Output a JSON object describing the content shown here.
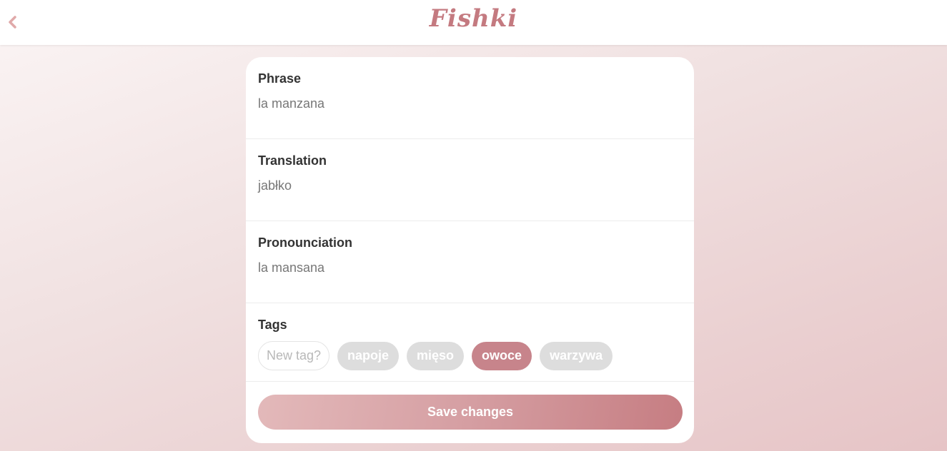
{
  "app": {
    "title": "Fishki",
    "back_icon": "chevron-left-icon",
    "accent_color": "#c7848b"
  },
  "form": {
    "phrase": {
      "label": "Phrase",
      "value": "la manzana"
    },
    "translation": {
      "label": "Translation",
      "value": "jabłko"
    },
    "pronounciation": {
      "label": "Pronounciation",
      "value": "la mansana"
    },
    "tags": {
      "label": "Tags",
      "input_placeholder": "New tag?",
      "items": [
        {
          "label": "napoje",
          "selected": false
        },
        {
          "label": "mięso",
          "selected": false
        },
        {
          "label": "owoce",
          "selected": true
        },
        {
          "label": "warzywa",
          "selected": false
        }
      ]
    },
    "save_label": "Save changes"
  }
}
